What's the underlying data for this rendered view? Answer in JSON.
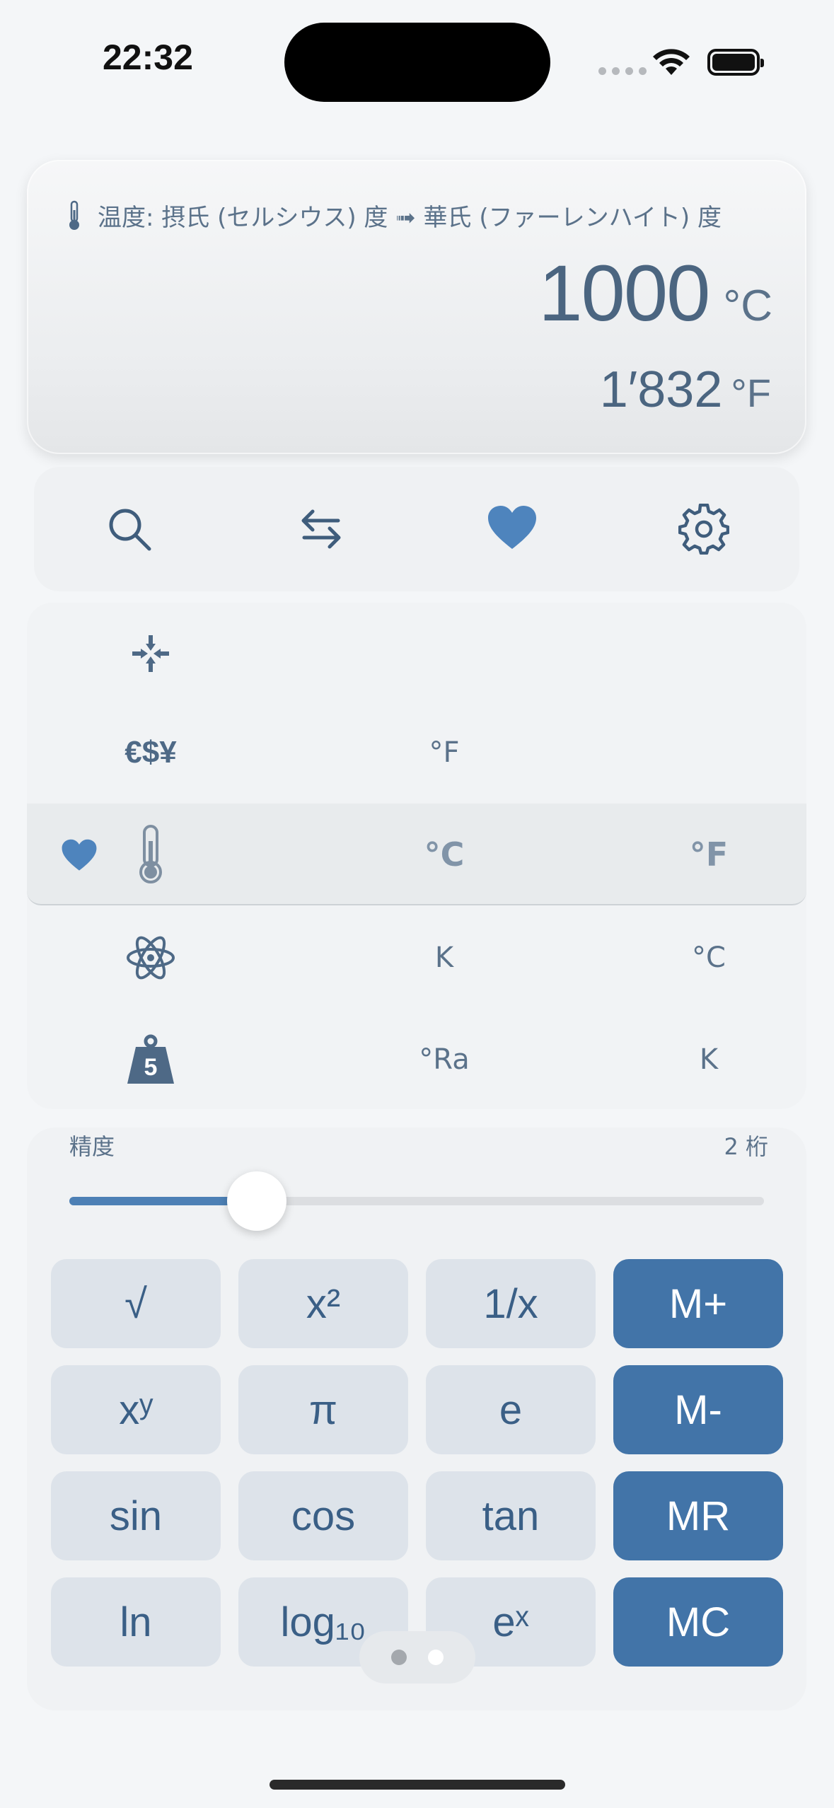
{
  "status_bar": {
    "time": "22:32"
  },
  "display": {
    "conversion_title": "温度: 摂氏 (セルシウス) 度 ➟ 華氏 (ファーレンハイト) 度",
    "input_value": "1000",
    "input_unit": "°C",
    "output_value": "1′832",
    "output_unit": "°F"
  },
  "toolbar": {
    "items": [
      "search-icon",
      "swap-icon",
      "heart-icon",
      "gear-icon"
    ]
  },
  "picker": {
    "rows": [
      {
        "icon": "compress-arrows-icon",
        "from": "",
        "to": ""
      },
      {
        "icon_text": "€$¥",
        "from": "°F",
        "to": ""
      },
      {
        "icon": "thermometer-icon",
        "favorite": true,
        "from": "°C",
        "to": "°F",
        "selected": true
      },
      {
        "icon": "atom-icon",
        "from": "K",
        "to": "°C"
      },
      {
        "icon": "weight-icon",
        "icon_text": "5",
        "from": "°Ra",
        "to": "K"
      }
    ]
  },
  "precision": {
    "label": "精度",
    "value_label": "2 桁",
    "slider_level": 0.27
  },
  "keypad": {
    "keys": [
      {
        "label": "√",
        "type": "function"
      },
      {
        "label": "x²",
        "type": "function"
      },
      {
        "label": "1/x",
        "type": "function"
      },
      {
        "label": "M+",
        "type": "memory"
      },
      {
        "label": "xʸ",
        "type": "function"
      },
      {
        "label": "π",
        "type": "function"
      },
      {
        "label": "e",
        "type": "function"
      },
      {
        "label": "M-",
        "type": "memory"
      },
      {
        "label": "sin",
        "type": "function"
      },
      {
        "label": "cos",
        "type": "function"
      },
      {
        "label": "tan",
        "type": "function"
      },
      {
        "label": "MR",
        "type": "memory"
      },
      {
        "label": "ln",
        "type": "function"
      },
      {
        "label": "log₁₀",
        "type": "function"
      },
      {
        "label": "eˣ",
        "type": "function"
      },
      {
        "label": "MC",
        "type": "memory"
      }
    ]
  },
  "pager": {
    "pages": 2,
    "current": 2
  },
  "colors": {
    "accent": "#4274a8",
    "key_background": "#dde3ea",
    "text": "#3d5a78",
    "slider_fill": "#4d80b5"
  }
}
